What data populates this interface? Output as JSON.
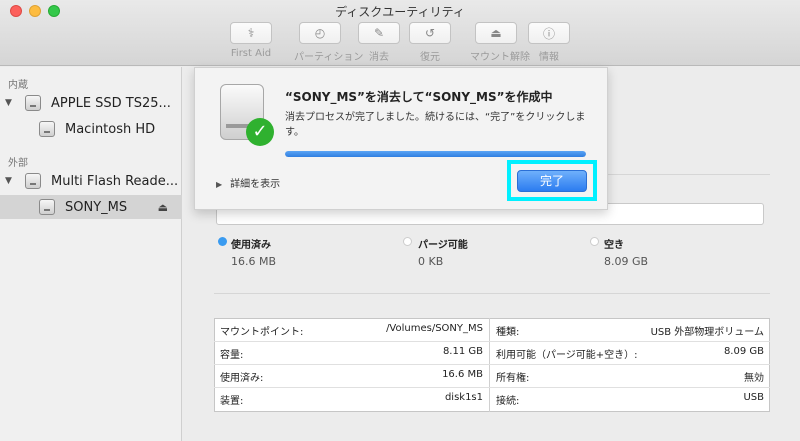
{
  "window": {
    "title": "ディスクユーティリティ"
  },
  "toolbar": [
    {
      "label": "First Aid",
      "icon": "stethoscope-icon",
      "glyph": "⚕"
    },
    {
      "label": "パーティション",
      "icon": "partition-icon",
      "glyph": "◴"
    },
    {
      "label": "消去",
      "icon": "erase-icon",
      "glyph": "✎"
    },
    {
      "label": "復元",
      "icon": "restore-icon",
      "glyph": "↺"
    },
    {
      "label": "マウント解除",
      "icon": "unmount-icon",
      "glyph": "⏏"
    },
    {
      "label": "情報",
      "icon": "info-icon",
      "glyph": "ⓘ"
    }
  ],
  "sidebar": {
    "internal_label": "内蔵",
    "external_label": "外部",
    "items": [
      {
        "label": "APPLE SSD TS25..."
      },
      {
        "label": "Macintosh HD"
      },
      {
        "label": "Multi Flash Reade..."
      },
      {
        "label": "SONY_MS"
      }
    ],
    "eject_glyph": "⏏"
  },
  "sheet": {
    "title": "“SONY_MS”を消去して“SONY_MS”を作成中",
    "body": "消去プロセスが完了しました。続けるには、“完了”をクリックします。",
    "progress": 1.0,
    "details_label": "詳細を表示",
    "done_label": "完了",
    "check_glyph": "✓"
  },
  "usage": [
    {
      "label": "使用済み",
      "value": "16.6 MB",
      "color": "#3a9bf0"
    },
    {
      "label": "パージ可能",
      "value": "0 KB",
      "color": "#ffffff"
    },
    {
      "label": "空き",
      "value": "8.09 GB",
      "color": "#ffffff"
    }
  ],
  "info": {
    "left": [
      {
        "key": "マウントポイント:",
        "value": "/Volumes/SONY_MS"
      },
      {
        "key": "容量:",
        "value": "8.11 GB"
      },
      {
        "key": "使用済み:",
        "value": "16.6 MB"
      },
      {
        "key": "装置:",
        "value": "disk1s1"
      }
    ],
    "right": [
      {
        "key": "種類:",
        "value": "USB 外部物理ボリューム"
      },
      {
        "key": "利用可能（パージ可能+空き）:",
        "value": "8.09 GB"
      },
      {
        "key": "所有権:",
        "value": "無効"
      },
      {
        "key": "接続:",
        "value": "USB"
      }
    ]
  },
  "colors": {
    "accent": "#2c7cf0",
    "highlight": "#00f0ff",
    "check": "#2fb12f"
  }
}
